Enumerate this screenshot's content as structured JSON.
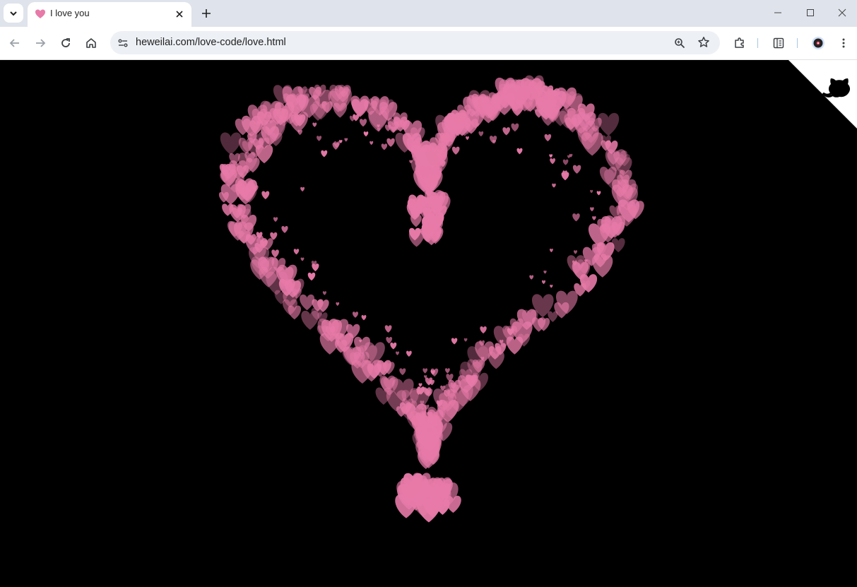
{
  "browser": {
    "tab": {
      "title": "I love you",
      "favicon": "pink-heart-icon"
    },
    "address_bar": {
      "url": "heweilai.com/love-code/love.html"
    },
    "toolbar_icons": [
      "back-icon",
      "forward-icon",
      "reload-icon",
      "home-icon",
      "site-info-icon",
      "zoom-icon",
      "bookmark-star-icon",
      "extensions-icon",
      "side-panel-icon",
      "profile-avatar",
      "menu-icon"
    ],
    "window_controls": [
      "minimize-icon",
      "maximize-icon",
      "close-icon"
    ]
  },
  "page": {
    "background": "#000000",
    "heart_color": "#e77aa8",
    "corner_badge": "github-octocat-corner"
  }
}
